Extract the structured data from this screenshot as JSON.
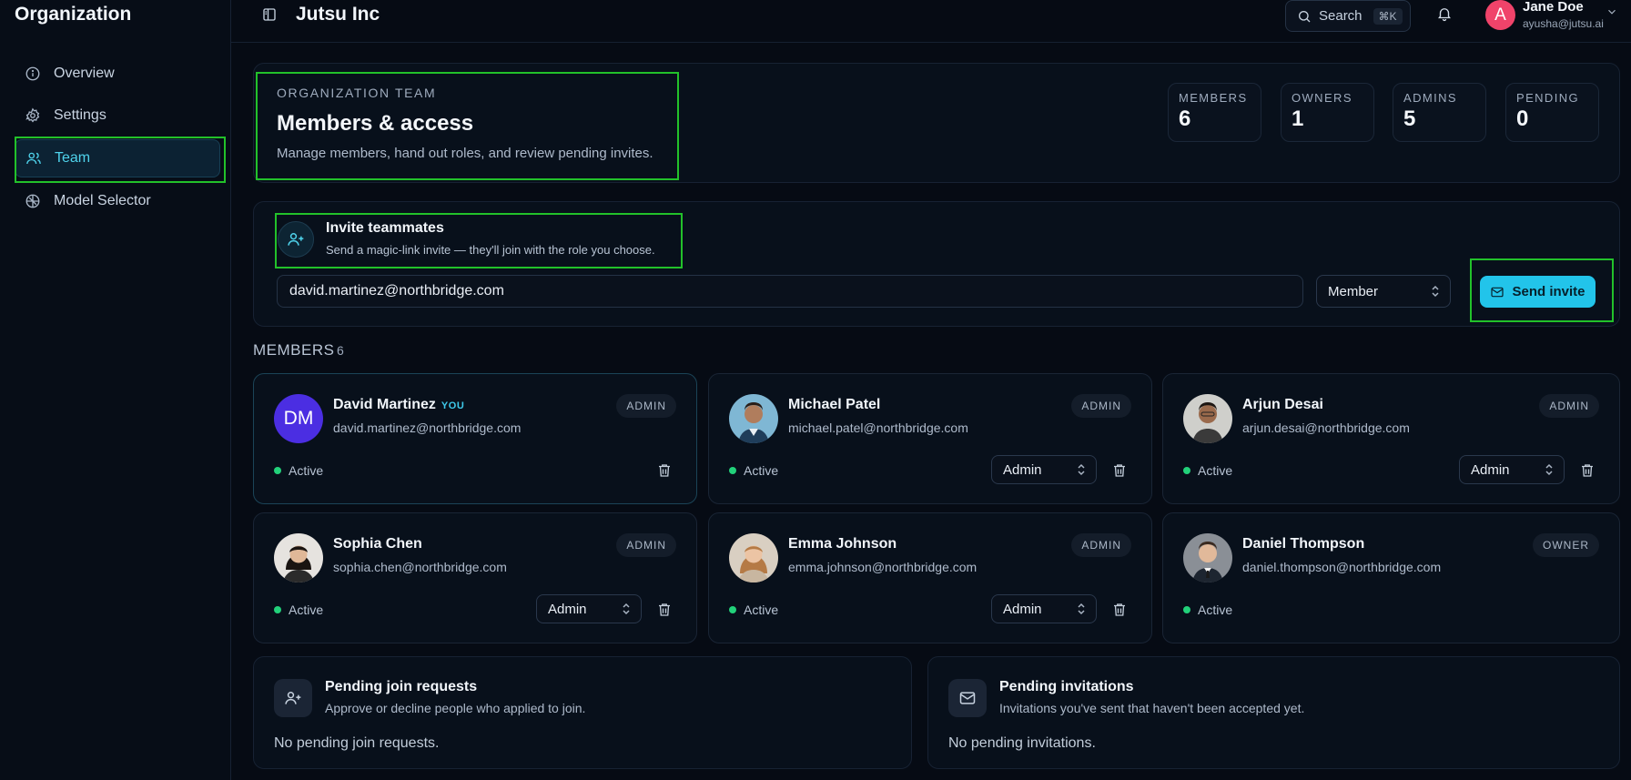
{
  "sidebar": {
    "title": "Organization",
    "items": [
      {
        "label": "Overview",
        "icon": "info-icon"
      },
      {
        "label": "Settings",
        "icon": "gear-icon"
      },
      {
        "label": "Team",
        "icon": "users-icon",
        "active": true
      },
      {
        "label": "Model Selector",
        "icon": "model-icon"
      }
    ]
  },
  "topbar": {
    "org_name": "Jutsu Inc",
    "search_label": "Search",
    "search_shortcut": "⌘K",
    "user_initial": "A",
    "user_name": "Jane Doe",
    "user_email": "ayusha@jutsu.ai"
  },
  "header": {
    "eyebrow": "ORGANIZATION TEAM",
    "title": "Members & access",
    "subtitle": "Manage members, hand out roles, and review pending invites.",
    "stats": [
      {
        "label": "MEMBERS",
        "value": "6"
      },
      {
        "label": "OWNERS",
        "value": "1"
      },
      {
        "label": "ADMINS",
        "value": "5"
      },
      {
        "label": "PENDING",
        "value": "0"
      }
    ]
  },
  "invite": {
    "title": "Invite teammates",
    "subtitle": "Send a magic-link invite — they'll join with the role you choose.",
    "email_value": "david.martinez@northbridge.com",
    "role_value": "Member",
    "send_label": "Send invite"
  },
  "members": {
    "section_title": "MEMBERS",
    "count": "6",
    "list": [
      {
        "name": "David Martinez",
        "you_tag": "YOU",
        "initials": "DM",
        "email": "david.martinez@northbridge.com",
        "role_badge": "ADMIN",
        "status": "Active",
        "role_select": ""
      },
      {
        "name": "Michael Patel",
        "email": "michael.patel@northbridge.com",
        "role_badge": "ADMIN",
        "status": "Active",
        "role_select": "Admin"
      },
      {
        "name": "Arjun Desai",
        "email": "arjun.desai@northbridge.com",
        "role_badge": "ADMIN",
        "status": "Active",
        "role_select": "Admin"
      },
      {
        "name": "Sophia Chen",
        "email": "sophia.chen@northbridge.com",
        "role_badge": "ADMIN",
        "status": "Active",
        "role_select": "Admin"
      },
      {
        "name": "Emma Johnson",
        "email": "emma.johnson@northbridge.com",
        "role_badge": "ADMIN",
        "status": "Active",
        "role_select": "Admin"
      },
      {
        "name": "Daniel Thompson",
        "email": "daniel.thompson@northbridge.com",
        "role_badge": "OWNER",
        "status": "Active",
        "role_select": ""
      }
    ]
  },
  "pending_requests": {
    "title": "Pending join requests",
    "subtitle": "Approve or decline people who applied to join.",
    "empty": "No pending join requests."
  },
  "pending_invitations": {
    "title": "Pending invitations",
    "subtitle": "Invitations you've sent that haven't been accepted yet.",
    "empty": "No pending invitations."
  },
  "colors": {
    "accent": "#22c4ea",
    "active_dot": "#22d17a",
    "highlight_box": "#22c12a",
    "avatar_user": "#f0436a",
    "avatar_dm": "#4b2ee2"
  }
}
